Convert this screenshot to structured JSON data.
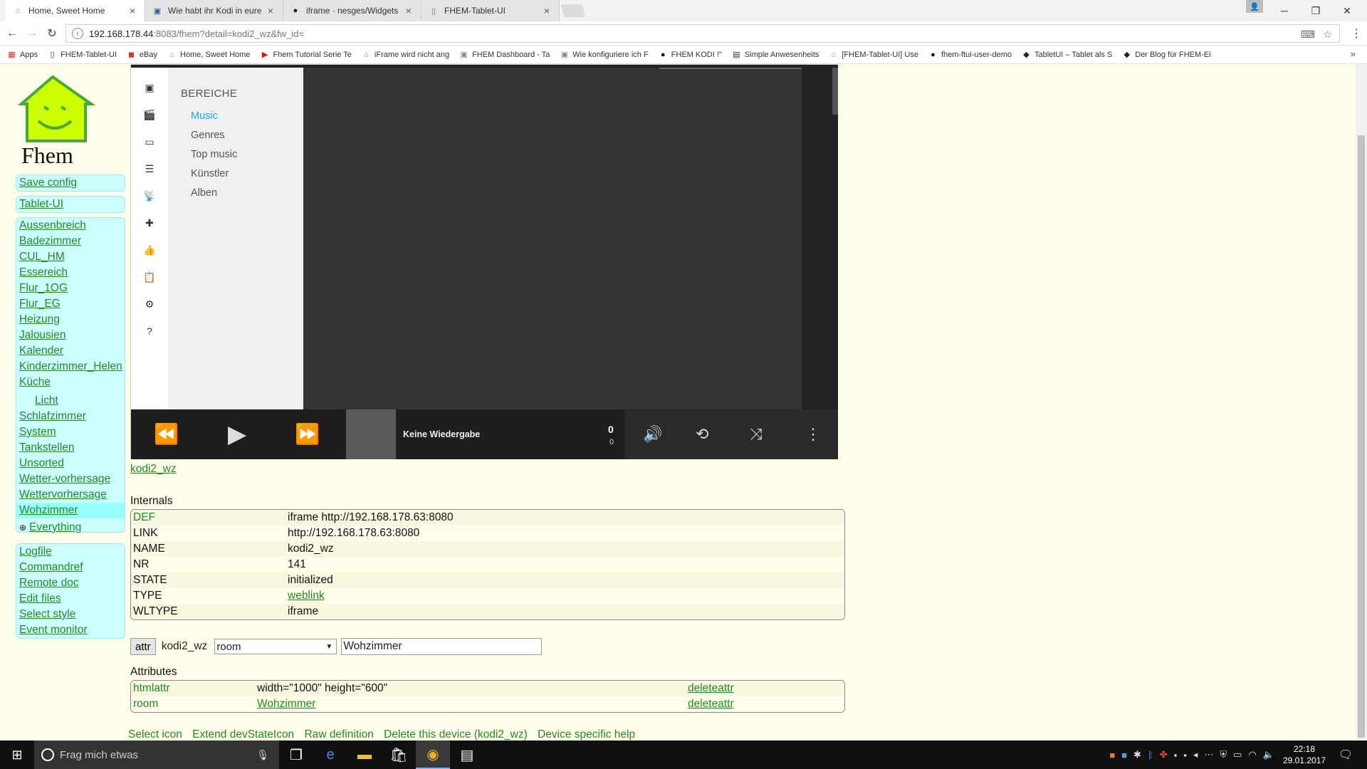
{
  "browser": {
    "tabs": [
      {
        "title": "Home, Sweet Home",
        "icon": "fhem-house-icon",
        "active": true
      },
      {
        "title": "Wie habt ihr Kodi in eure",
        "icon": "forum-icon",
        "active": false
      },
      {
        "title": "iframe · nesges/Widgets",
        "icon": "github-icon",
        "active": false
      },
      {
        "title": "FHEM-Tablet-UI",
        "icon": "page-icon",
        "active": false
      }
    ],
    "tab_close": "×",
    "url_host": "192.168.178.44",
    "url_path": ":8083/fhem?detail=kodi2_wz&fw_id=",
    "bookmarks": [
      {
        "label": "Apps",
        "icon": "apps-grid-icon"
      },
      {
        "label": "FHEM-Tablet-UI",
        "icon": "page-icon"
      },
      {
        "label": "eBay",
        "icon": "ebay-icon"
      },
      {
        "label": "Home, Sweet Home",
        "icon": "fhem-house-icon"
      },
      {
        "label": "Fhem Tutorial Serie Te",
        "icon": "youtube-icon"
      },
      {
        "label": "iFrame wird nicht ang",
        "icon": "fhem-house-icon"
      },
      {
        "label": "FHEM Dashboard - Ta",
        "icon": "forum-icon"
      },
      {
        "label": "Wie konfiguriere ich F",
        "icon": "forum-icon"
      },
      {
        "label": "FHEM KODI !\"",
        "icon": "github-icon"
      },
      {
        "label": "Simple Anwesenheits",
        "icon": "site-icon"
      },
      {
        "label": "[FHEM-Tablet-UI] Use",
        "icon": "fhem-house-icon"
      },
      {
        "label": "fhem-ftui-user-demo",
        "icon": "github-icon"
      },
      {
        "label": "TabletUI – Tablet als S",
        "icon": "blog-icon"
      },
      {
        "label": "Der Blog für FHEM-Ei",
        "icon": "blog-icon"
      }
    ],
    "bookmarks_more": "»"
  },
  "menu": {
    "logo_text": "Fhem",
    "top": [
      {
        "label": "Save config"
      },
      {
        "label": "Tablet-UI"
      }
    ],
    "rooms": [
      {
        "label": "Aussenbreich",
        "selected": false,
        "indent": false
      },
      {
        "label": "Badezimmer",
        "selected": false,
        "indent": false
      },
      {
        "label": "CUL_HM",
        "selected": false,
        "indent": false
      },
      {
        "label": "Essereich",
        "selected": false,
        "indent": false
      },
      {
        "label": "Flur_1OG",
        "selected": false,
        "indent": false
      },
      {
        "label": "Flur_EG",
        "selected": false,
        "indent": false
      },
      {
        "label": "Heizung",
        "selected": false,
        "indent": false
      },
      {
        "label": "Jalousien",
        "selected": false,
        "indent": false
      },
      {
        "label": "Kalender",
        "selected": false,
        "indent": false
      },
      {
        "label": "Kinderzimmer_Helen",
        "selected": false,
        "indent": false
      },
      {
        "label": "Küche",
        "selected": false,
        "indent": false
      },
      {
        "label": "Licht",
        "selected": false,
        "indent": true
      },
      {
        "label": "Schlafzimmer",
        "selected": false,
        "indent": false
      },
      {
        "label": "System",
        "selected": false,
        "indent": false
      },
      {
        "label": "Tankstellen",
        "selected": false,
        "indent": false
      },
      {
        "label": "Unsorted",
        "selected": false,
        "indent": false
      },
      {
        "label": "Wetter-vorhersage",
        "selected": false,
        "indent": false
      },
      {
        "label": "Wettervorhersage",
        "selected": false,
        "indent": false
      },
      {
        "label": "Wohzimmer",
        "selected": true,
        "indent": false
      },
      {
        "label": "Everything",
        "selected": false,
        "indent": true,
        "globe": true
      }
    ],
    "tools": [
      {
        "label": "Logfile"
      },
      {
        "label": "Commandref"
      },
      {
        "label": "Remote doc"
      },
      {
        "label": "Edit files"
      },
      {
        "label": "Select style"
      },
      {
        "label": "Event monitor"
      }
    ]
  },
  "kodi": {
    "section_title": "BEREICHE",
    "menu_items": [
      {
        "label": "Music",
        "active": true
      },
      {
        "label": "Genres",
        "active": false
      },
      {
        "label": "Top music",
        "active": false
      },
      {
        "label": "Künstler",
        "active": false
      },
      {
        "label": "Alben",
        "active": false
      }
    ],
    "left_icons": [
      "music-library-icon",
      "movies-icon",
      "tv-icon",
      "playlist-icon",
      "radio-icon",
      "addons-icon",
      "thumbs-up-icon",
      "clipboard-icon",
      "settings-icon",
      "help-icon"
    ],
    "now_playing": "Keine Wiedergabe",
    "time_current": "0",
    "time_total": "0"
  },
  "device": {
    "name": "kodi2_wz",
    "internals_title": "Internals",
    "internals": [
      {
        "key": "DEF",
        "value": "iframe http://192.168.178.63:8080",
        "link": false,
        "keycolor": "green"
      },
      {
        "key": "LINK",
        "value": "http://192.168.178.63:8080",
        "link": false
      },
      {
        "key": "NAME",
        "value": "kodi2_wz",
        "link": false
      },
      {
        "key": "NR",
        "value": "141",
        "link": false
      },
      {
        "key": "STATE",
        "value": "initialized",
        "link": false
      },
      {
        "key": "TYPE",
        "value": "weblink",
        "link": true
      },
      {
        "key": "WLTYPE",
        "value": "iframe",
        "link": false
      }
    ],
    "attr_button": "attr",
    "attr_device": "kodi2_wz",
    "attr_select": "room",
    "attr_value": "Wohzimmer",
    "attributes_title": "Attributes",
    "attributes": [
      {
        "key": "htmlattr",
        "value": "width=\"1000\" height=\"600\"",
        "link": false,
        "action": "deleteattr"
      },
      {
        "key": "room",
        "value": "Wohzimmer",
        "link": true,
        "action": "deleteattr"
      }
    ],
    "bottom_links": [
      "Select icon",
      "Extend devStateIcon",
      "Raw definition",
      "Delete this device (kodi2_wz)",
      "Device specific help"
    ]
  },
  "taskbar": {
    "search_placeholder": "Frag mich etwas",
    "time": "22:18",
    "date": "29.01.2017"
  }
}
